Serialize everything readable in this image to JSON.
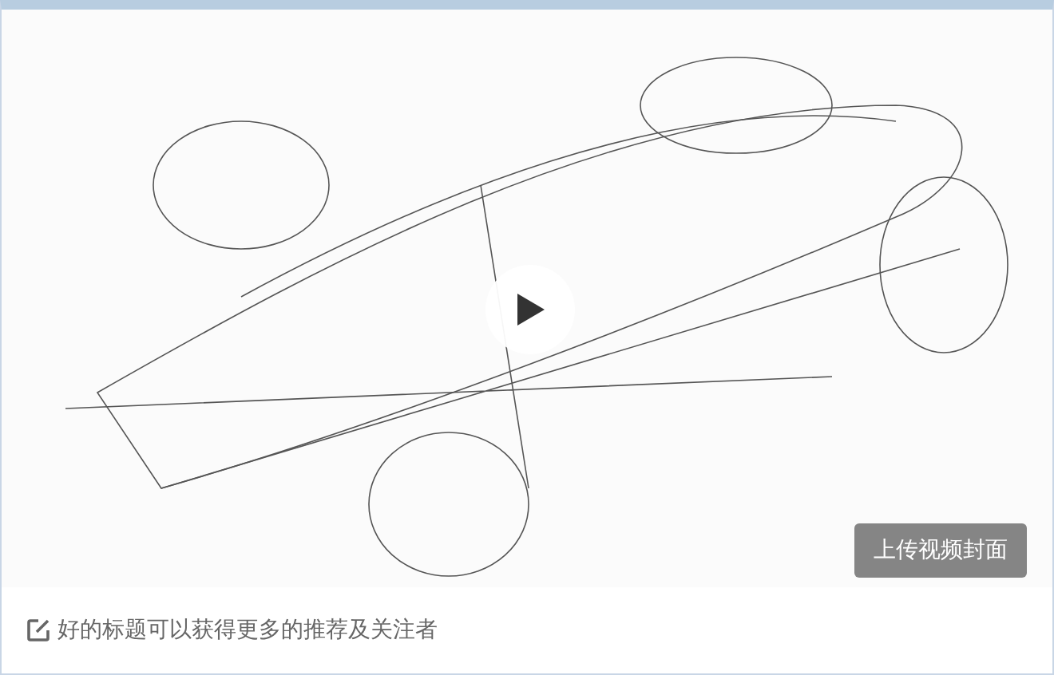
{
  "video": {
    "upload_cover_button": "上传视频封面"
  },
  "caption": {
    "hint": "好的标题可以获得更多的推荐及关注者"
  }
}
